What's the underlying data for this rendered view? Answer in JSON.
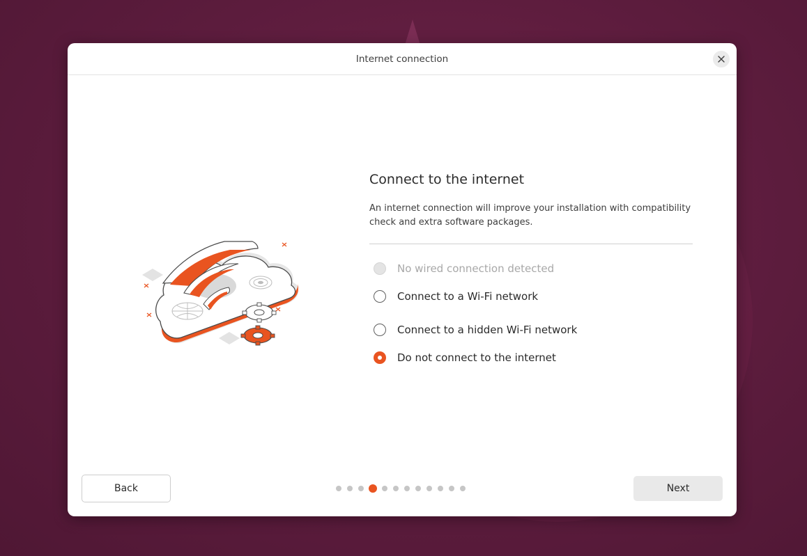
{
  "dialog": {
    "title": "Internet connection",
    "close_icon": "close-icon"
  },
  "main": {
    "heading": "Connect to the internet",
    "description": "An internet connection will improve your installation with compatibility check and extra software packages.",
    "illustration_icon": "wifi-cloud-illustration",
    "options": [
      {
        "label": "No wired connection detected",
        "state": "disabled"
      },
      {
        "label": "Connect to a Wi-Fi network",
        "state": "unchecked"
      },
      {
        "label": "Connect to a hidden Wi-Fi network",
        "state": "unchecked"
      },
      {
        "label": "Do not connect to the internet",
        "state": "checked"
      }
    ]
  },
  "footer": {
    "back_label": "Back",
    "next_label": "Next",
    "pager": {
      "total_steps": 12,
      "current_step": 4
    }
  },
  "colors": {
    "accent": "#e95420",
    "background": "#5c1c3d",
    "dialog": "#ffffff"
  }
}
